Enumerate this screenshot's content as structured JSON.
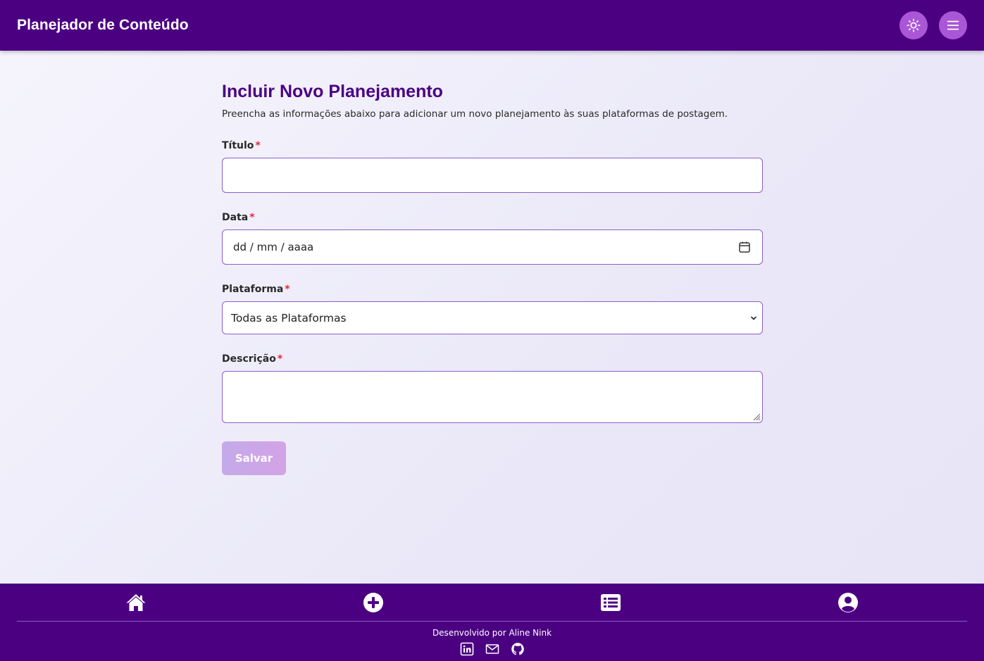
{
  "header": {
    "title": "Planejador de Conteúdo",
    "theme_icon": "sun-icon",
    "menu_icon": "hamburger-menu-icon"
  },
  "form": {
    "title": "Incluir Novo Planejamento",
    "subtitle": "Preencha as informações abaixo para adicionar um novo planejamento às suas plataformas de postagem.",
    "required_mark": "*",
    "fields": {
      "titulo": {
        "label": "Título",
        "value": ""
      },
      "data": {
        "label": "Data",
        "placeholder": "dd / mm / aaaa",
        "icon": "calendar-icon"
      },
      "plataforma": {
        "label": "Plataforma",
        "selected": "Todas as Plataformas"
      },
      "descricao": {
        "label": "Descrição",
        "value": ""
      }
    },
    "save_label": "Salvar"
  },
  "bottom_nav": {
    "items": [
      {
        "icon": "home-icon"
      },
      {
        "icon": "plus-circle-icon"
      },
      {
        "icon": "list-icon"
      },
      {
        "icon": "user-circle-icon"
      }
    ]
  },
  "footer": {
    "credit": "Desenvolvido por Aline Nink",
    "social": [
      "linkedin-icon",
      "mail-icon",
      "github-icon"
    ]
  },
  "colors": {
    "primary": "#4b0082",
    "accent": "#a957d6",
    "required": "#e0283c",
    "border": "#8c5ec9"
  }
}
